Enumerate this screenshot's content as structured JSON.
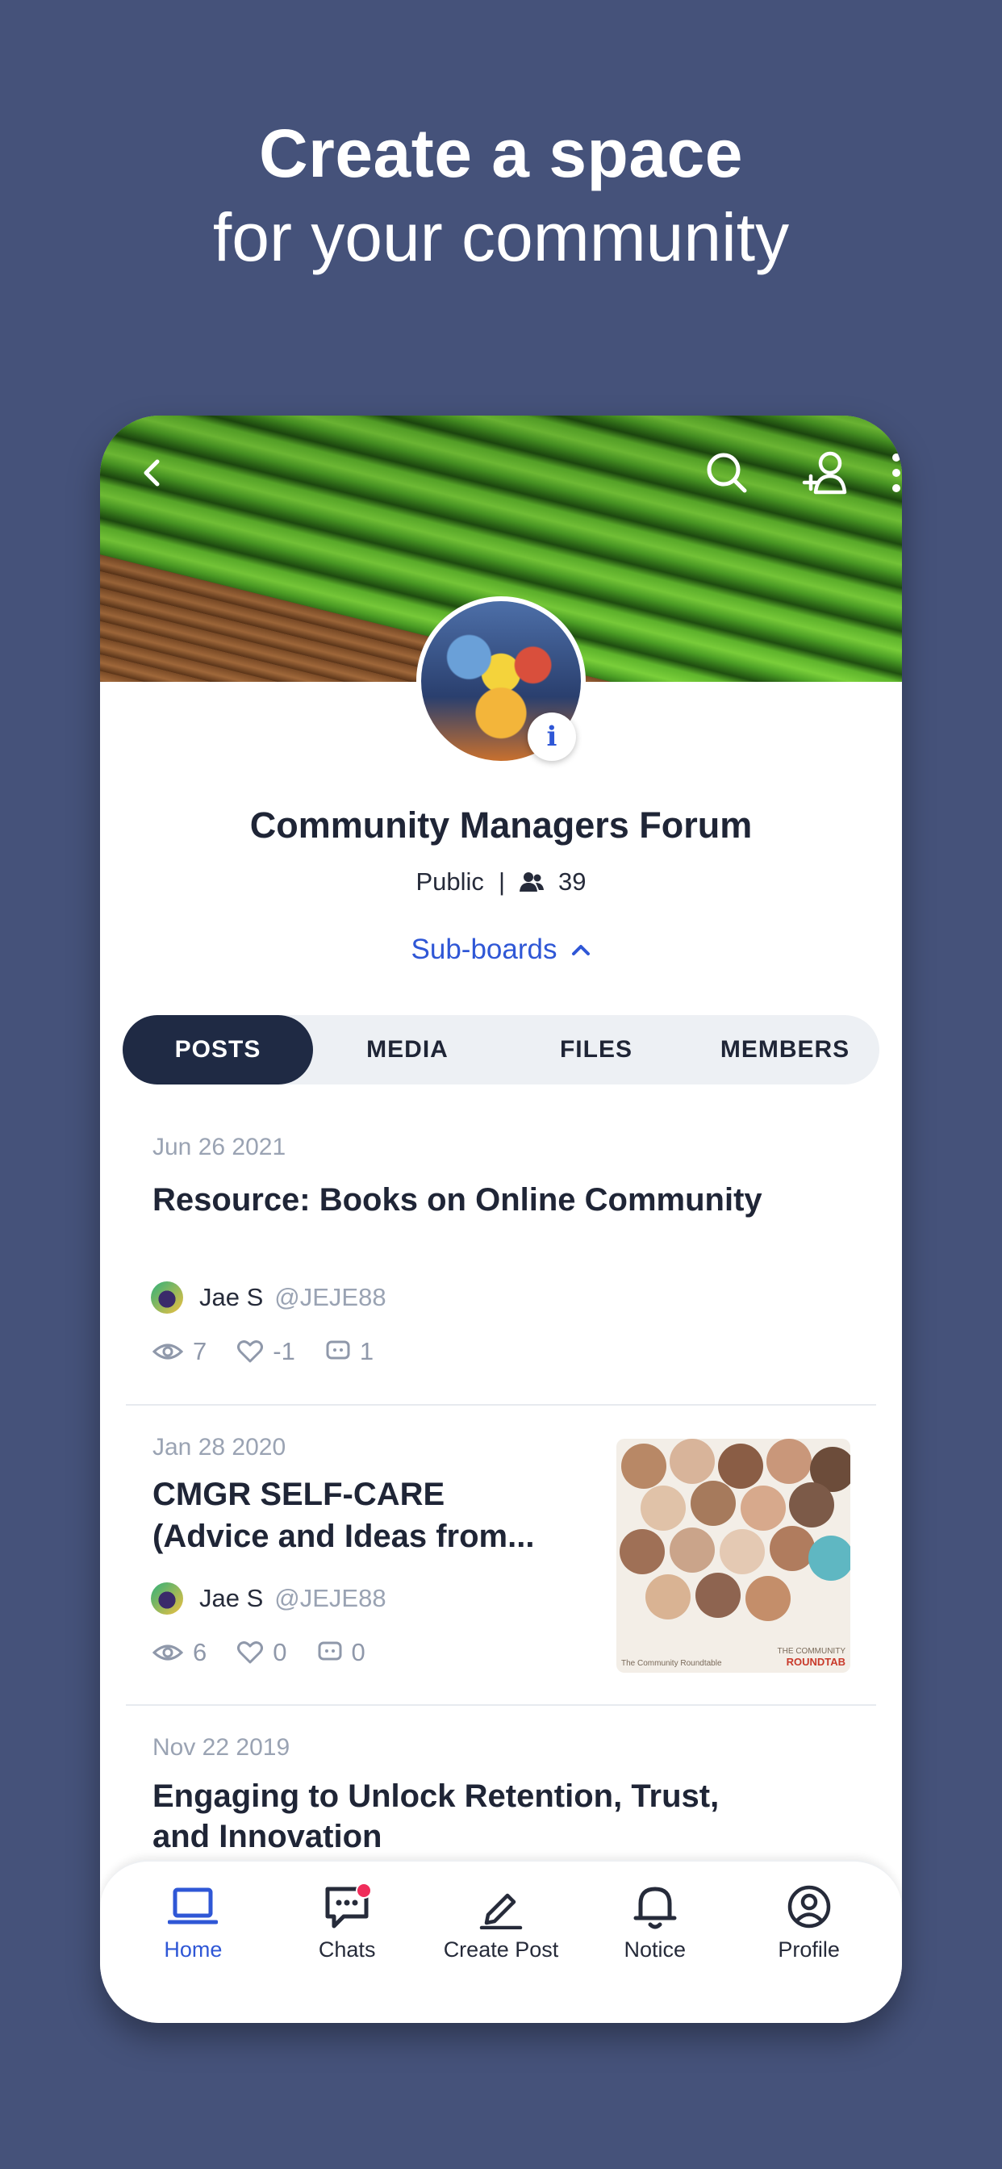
{
  "promo": {
    "line1": "Create a space",
    "line2": "for your community"
  },
  "header": {
    "back_icon": "back-icon",
    "search_icon": "search-icon",
    "add_member_icon": "add-user-icon",
    "more_icon": "more-vertical-icon"
  },
  "forum": {
    "title": "Community Managers Forum",
    "visibility": "Public",
    "separator": "|",
    "member_count": "39",
    "info_badge": "i",
    "subboards_label": "Sub-boards"
  },
  "tabs": [
    {
      "label": "POSTS",
      "active": true
    },
    {
      "label": "MEDIA",
      "active": false
    },
    {
      "label": "FILES",
      "active": false
    },
    {
      "label": "MEMBERS",
      "active": false
    }
  ],
  "posts": [
    {
      "date": "Jun 26 2021",
      "title": "Resource: Books on Online Community",
      "author": "Jae S",
      "handle": "@JEJE88",
      "views": "7",
      "likes": "-1",
      "comments": "1"
    },
    {
      "date": "Jan 28 2020",
      "title_line1": "CMGR SELF-CARE",
      "title_line2": "(Advice and Ideas from...",
      "author": "Jae S",
      "handle": "@JEJE88",
      "views": "6",
      "likes": "0",
      "comments": "0",
      "thumbnail_caption_left": "The Community Roundtable",
      "thumbnail_caption_right_1": "THE COMMUNITY",
      "thumbnail_caption_right_2": "ROUNDTAB"
    },
    {
      "date": "Nov 22 2019",
      "title_line1": "Engaging to Unlock Retention, Trust,",
      "title_line2": "and Innovation"
    }
  ],
  "bottom_nav": [
    {
      "label": "Home",
      "icon": "laptop-icon",
      "active": true
    },
    {
      "label": "Chats",
      "icon": "chat-icon",
      "active": false,
      "badge": true
    },
    {
      "label": "Create Post",
      "icon": "pencil-icon",
      "active": false
    },
    {
      "label": "Notice",
      "icon": "bell-icon",
      "active": false
    },
    {
      "label": "Profile",
      "icon": "user-circle-icon",
      "active": false
    }
  ],
  "colors": {
    "background": "#45527a",
    "accent": "#2f57d6",
    "active_tab": "#1f2a44",
    "badge": "#f02c5a"
  }
}
